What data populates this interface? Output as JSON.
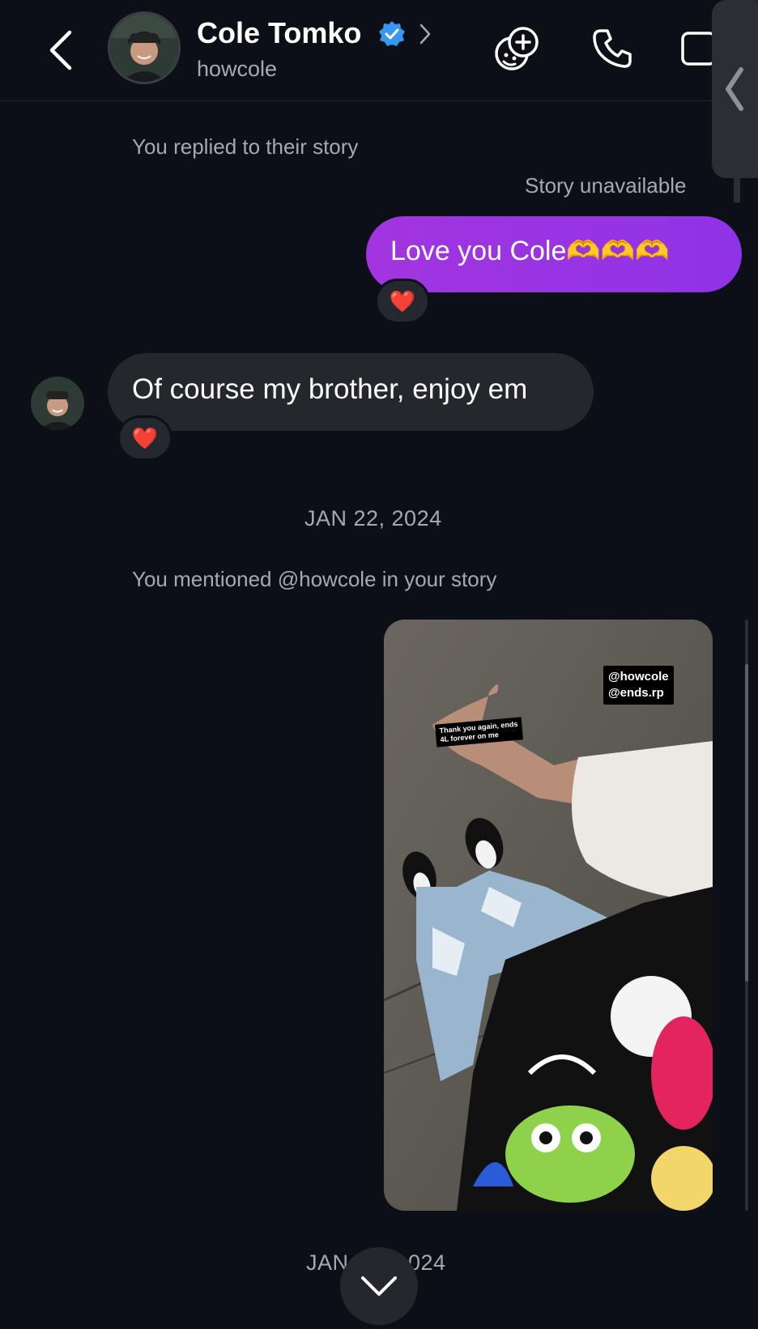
{
  "header": {
    "back_icon": "chevron-left-icon",
    "contact_name": "Cole Tomko",
    "verified_icon": "verified-badge-icon",
    "profile_chevron_icon": "chevron-right-icon",
    "handle": "howcole",
    "actions": [
      "effects-icon",
      "phone-icon",
      "video-icon"
    ]
  },
  "thread": {
    "story_reply_note": "You replied to their story",
    "story_unavailable": "Story unavailable",
    "outgoing_message": "Love you Cole🫶🫶🫶",
    "outgoing_reaction": "❤️",
    "incoming_message": "Of course my brother, enjoy em",
    "incoming_reaction": "❤️",
    "date_1": "JAN 22, 2024",
    "mention_note": "You mentioned @howcole in your story",
    "story_mentions": [
      "@howcole",
      "@ends.rp"
    ],
    "story_note_line1": "Thank you again, ends",
    "story_note_line2": "4L forever on me",
    "date_2_partial_left": "JAN",
    "date_2_partial_right": "024"
  },
  "colors": {
    "background": "#0c0f15",
    "outgoing_bubble": "#a235e0",
    "incoming_bubble": "#25272c",
    "verified": "#3897f0"
  }
}
